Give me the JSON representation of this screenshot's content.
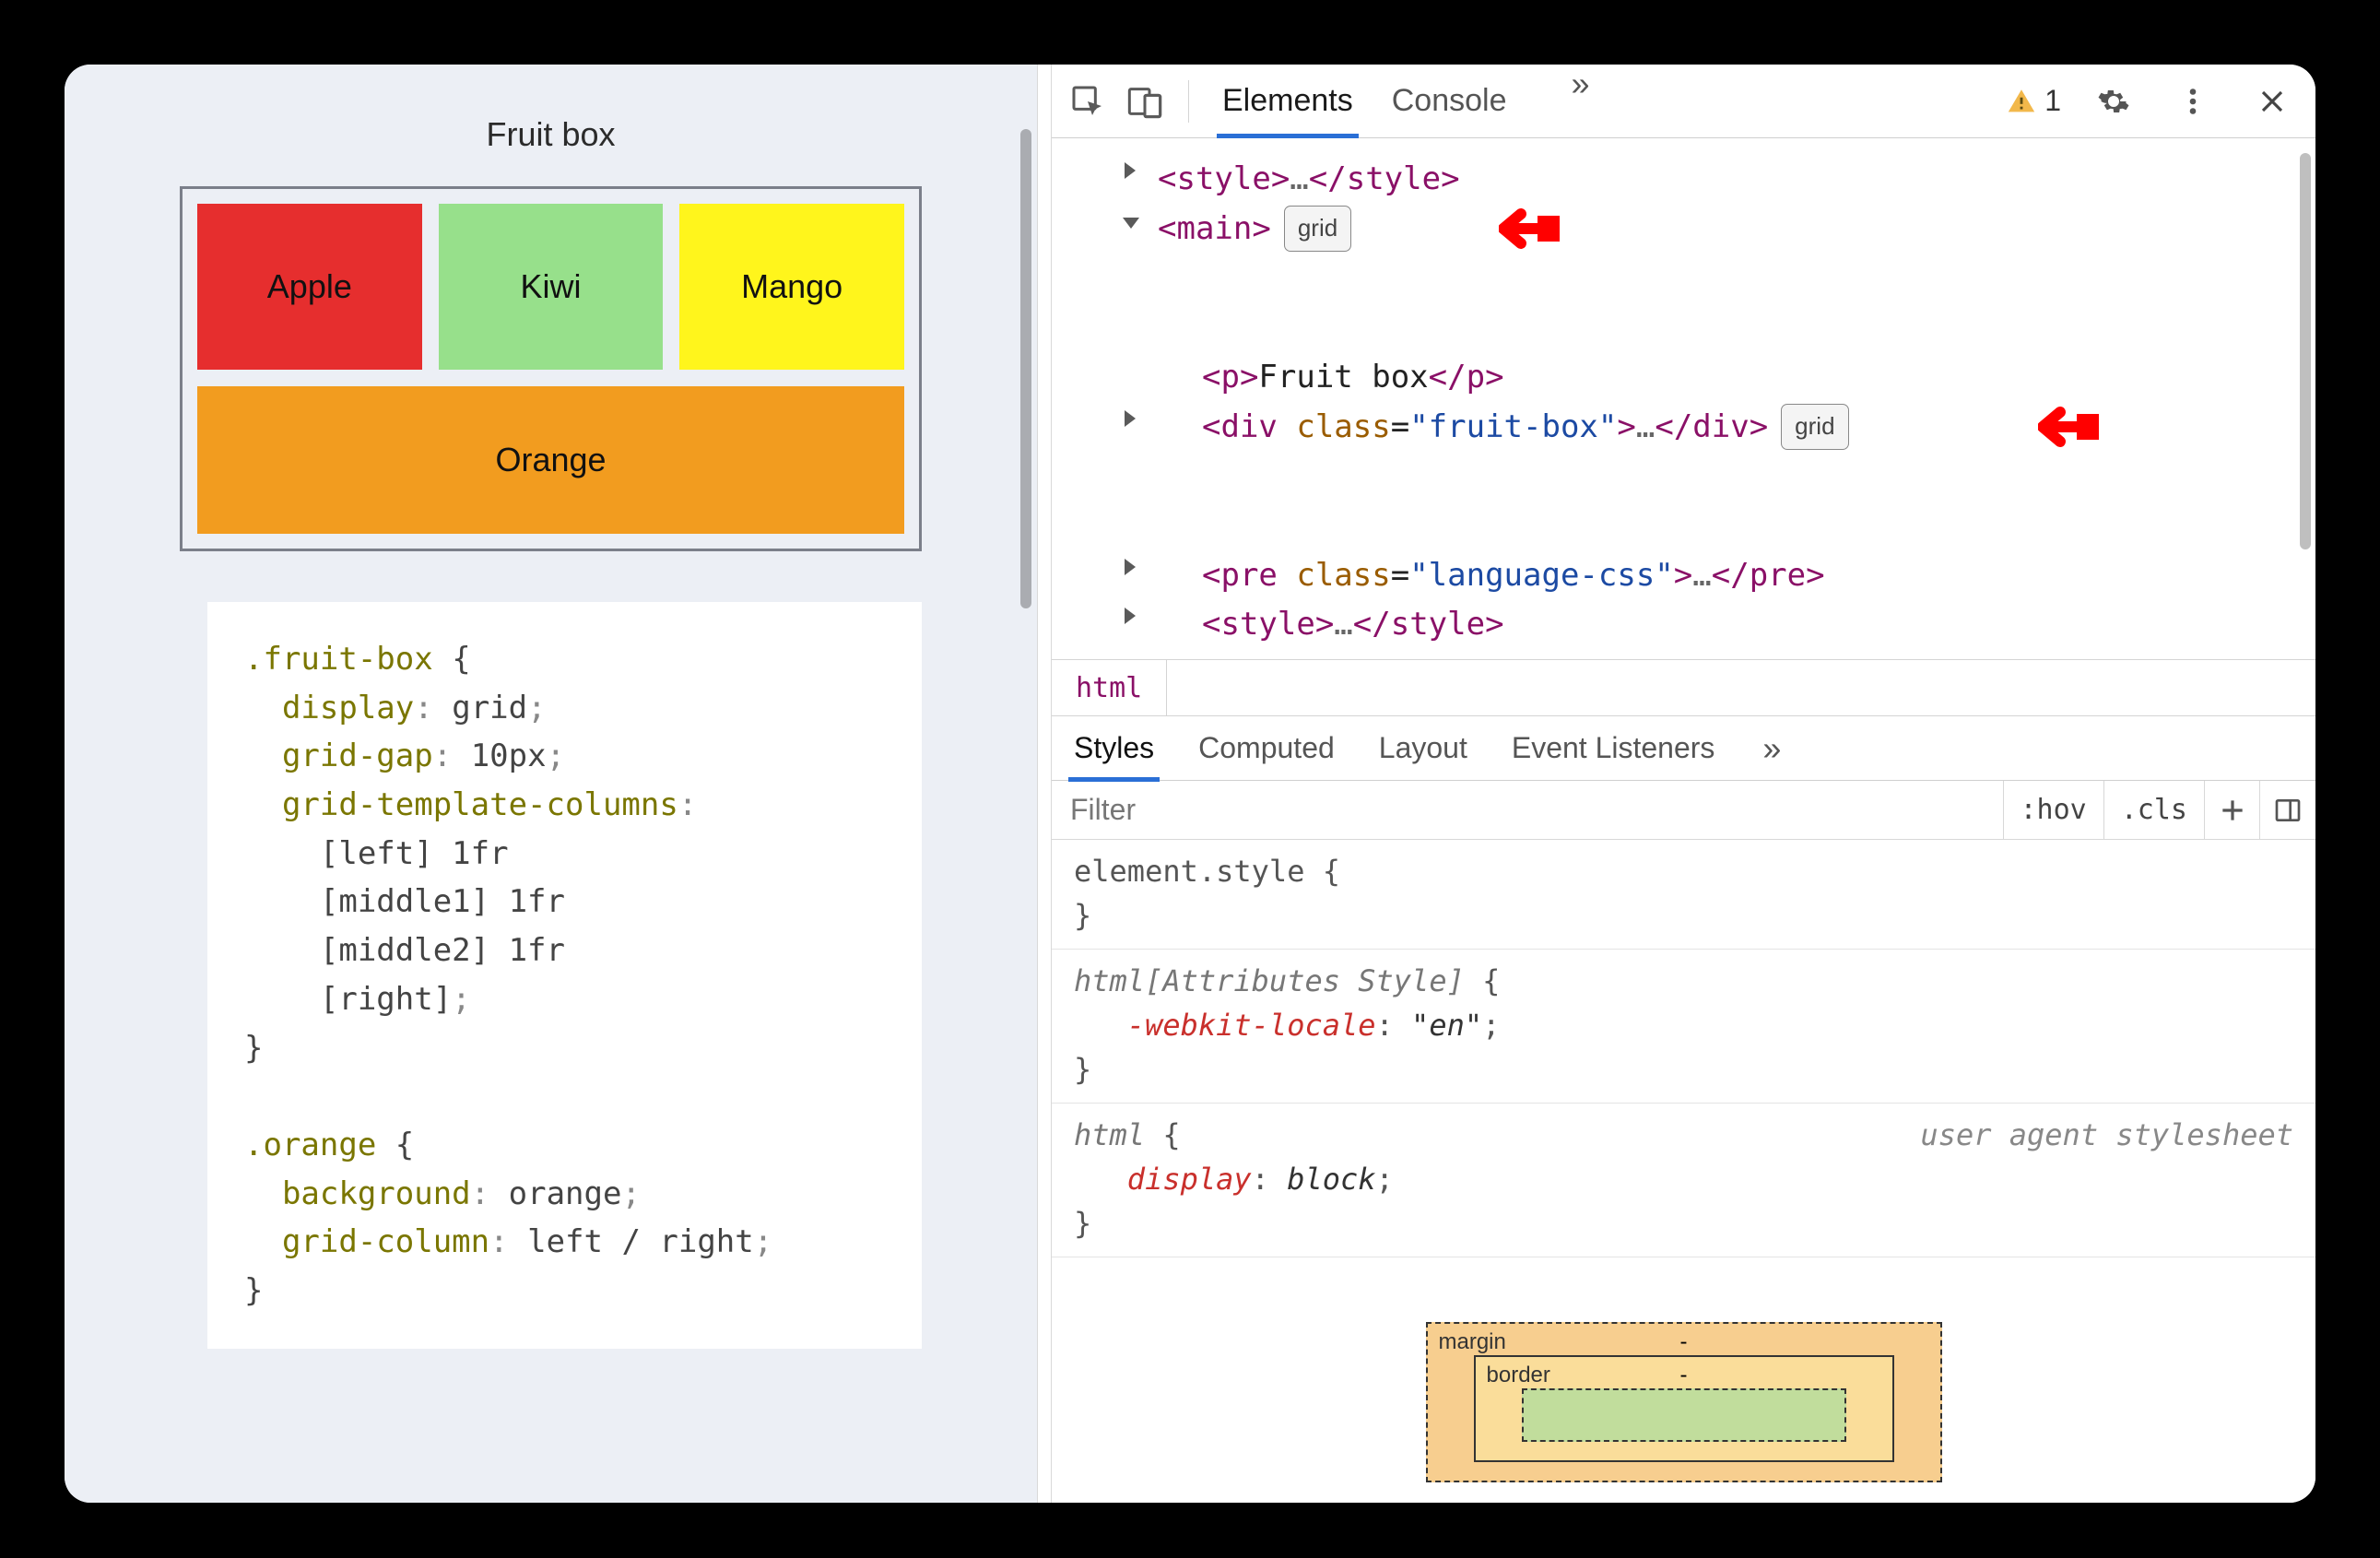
{
  "page": {
    "title": "Fruit box",
    "fruits": {
      "apple": "Apple",
      "kiwi": "Kiwi",
      "mango": "Mango",
      "orange": "Orange"
    }
  },
  "code": {
    "sel1": ".fruit-box",
    "p_display": "display",
    "v_display": "grid",
    "p_gap": "grid-gap",
    "v_gap": "10px",
    "p_cols": "grid-template-columns",
    "col1": "[left] 1fr",
    "col2": "[middle1] 1fr",
    "col3": "[middle2] 1fr",
    "col4": "[right]",
    "sel2": ".orange",
    "p_bg": "background",
    "v_bg": "orange",
    "p_gc": "grid-column",
    "v_gc": "left / right"
  },
  "devtools": {
    "tabs": {
      "elements": "Elements",
      "console": "Console"
    },
    "more": "»",
    "warning_count": "1",
    "domTree": {
      "style1_open": "<style>",
      "style1_close": "</style>",
      "dots": "…",
      "main_open": "<main>",
      "grid_badge": "grid",
      "p_open": "<p>",
      "p_text": "Fruit box",
      "p_close": "</p>",
      "div_open": "<div ",
      "div_attr": "class",
      "div_eq": "=",
      "div_val": "\"fruit-box\"",
      "div_gt": ">",
      "div_close": "</div>",
      "pre_open": "<pre ",
      "pre_attr": "class",
      "pre_eq": "=",
      "pre_val": "\"language-css\"",
      "pre_gt": ">",
      "pre_close": "</pre>",
      "style2_open": "<style>",
      "style2_close": "</style>"
    },
    "crumb": "html",
    "subtabs": {
      "styles": "Styles",
      "computed": "Computed",
      "layout": "Layout",
      "listeners": "Event Listeners"
    },
    "filter": {
      "placeholder": "Filter",
      "hov": ":hov",
      "cls": ".cls"
    },
    "rules": {
      "r1_sel": "element.style",
      "r2_sel": "html[Attributes Style]",
      "r2_prop": "-webkit-locale",
      "r2_val": "\"en\"",
      "r3_sel": "html",
      "r3_origin": "user agent stylesheet",
      "r3_prop": "display",
      "r3_val": "block"
    },
    "boxmodel": {
      "margin": "margin",
      "border": "border",
      "dash": "-"
    }
  }
}
